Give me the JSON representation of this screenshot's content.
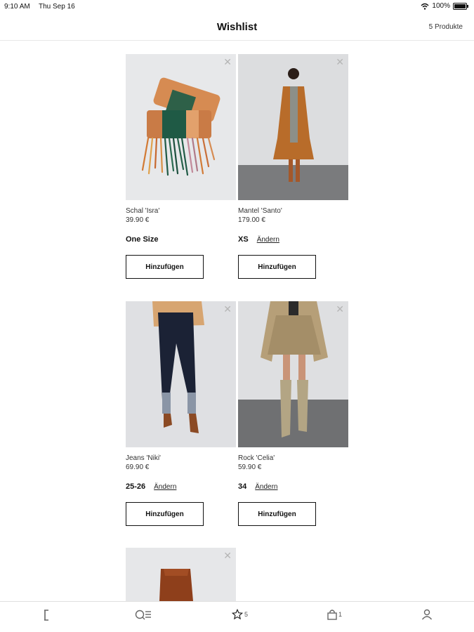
{
  "status_bar": {
    "time": "9:10 AM",
    "date": "Thu Sep 16",
    "battery": "100%"
  },
  "header": {
    "title": "Wishlist",
    "count": "5 Produkte"
  },
  "products": [
    {
      "name": "Schal 'Isra'",
      "price": "39.90 €",
      "size": "One Size",
      "change": "",
      "button": "Hinzufügen"
    },
    {
      "name": "Mantel 'Santo'",
      "price": "179.00 €",
      "size": "XS",
      "change": "Ändern",
      "button": "Hinzufügen"
    },
    {
      "name": "Jeans 'Niki'",
      "price": "69.90 €",
      "size": "25-26",
      "change": "Ändern",
      "button": "Hinzufügen"
    },
    {
      "name": "Rock 'Celia'",
      "price": "59.90 €",
      "size": "34",
      "change": "Ändern",
      "button": "Hinzufügen"
    },
    {
      "name": "",
      "price": "",
      "size": "",
      "change": "",
      "button": ""
    }
  ],
  "tabbar": {
    "wishlist_count": "5",
    "bag_count": "1"
  },
  "icons": [
    "wifi-icon",
    "battery-icon",
    "close-icon",
    "home-icon",
    "search-menu-icon",
    "star-icon",
    "bag-icon",
    "profile-icon"
  ]
}
